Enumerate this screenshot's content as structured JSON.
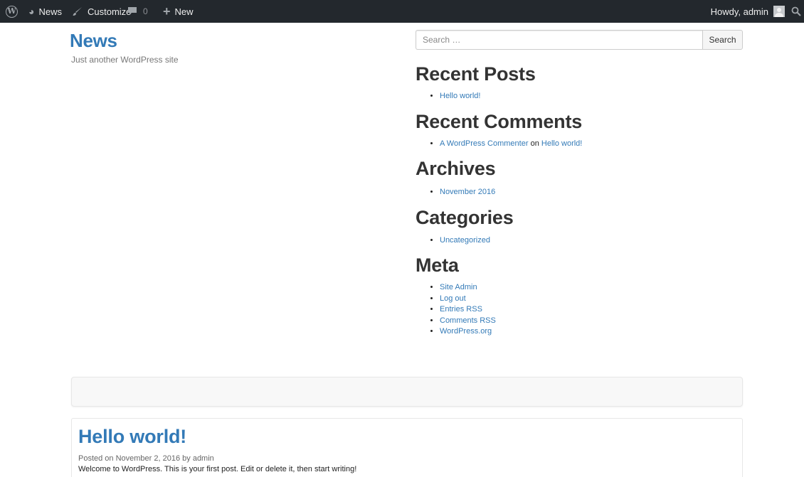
{
  "adminbar": {
    "site_name": "News",
    "customize": "Customize",
    "comments_count": "0",
    "new": "New",
    "howdy": "Howdy, admin",
    "icons": [
      "wordpress-logo-icon",
      "dashboard-icon",
      "brush-icon",
      "comment-icon",
      "plus-icon",
      "avatar",
      "search-icon"
    ]
  },
  "site": {
    "title": "News",
    "description": "Just another WordPress site"
  },
  "search": {
    "placeholder": "Search …",
    "button": "Search"
  },
  "widgets": {
    "recent_posts": {
      "title": "Recent Posts",
      "items": [
        "Hello world!"
      ]
    },
    "recent_comments": {
      "title": "Recent Comments",
      "author": "A WordPress Commenter",
      "on": "on",
      "post": "Hello world!"
    },
    "archives": {
      "title": "Archives",
      "items": [
        "November 2016"
      ]
    },
    "categories": {
      "title": "Categories",
      "items": [
        "Uncategorized"
      ]
    },
    "meta": {
      "title": "Meta",
      "items": [
        "Site Admin",
        "Log out",
        "Entries RSS",
        "Comments RSS",
        "WordPress.org"
      ]
    }
  },
  "post": {
    "title": "Hello world!",
    "posted_on": "Posted on November 2, 2016 by admin",
    "content": "Welcome to WordPress. This is your first post. Edit or delete it, then start writing!"
  },
  "colors": {
    "adminbar_bg": "#23282d",
    "link": "#337ab7"
  }
}
